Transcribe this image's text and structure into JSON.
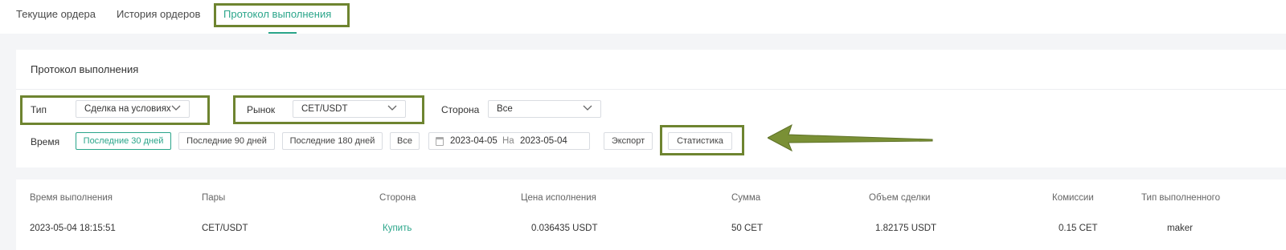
{
  "tabs": [
    {
      "label": "Текущие ордера"
    },
    {
      "label": "История ордеров"
    },
    {
      "label": "Протокол выполнения"
    }
  ],
  "panel": {
    "title": "Протокол выполнения",
    "type_label": "Тип",
    "type_value": "Сделка на условиях",
    "market_label": "Рынок",
    "market_value": "CET/USDT",
    "side_label": "Сторона",
    "side_value": "Все",
    "time_label": "Время",
    "time_buttons": [
      {
        "label": "Последние 30 дней",
        "active": true
      },
      {
        "label": "Последние 90 дней"
      },
      {
        "label": "Последние 180 дней"
      },
      {
        "label": "Все"
      }
    ],
    "date_from": "2023-04-05",
    "date_separator": "На",
    "date_to": "2023-05-04",
    "export_label": "Экспорт",
    "stats_label": "Статистика"
  },
  "table": {
    "headers": [
      "Время выполнения",
      "Пары",
      "Сторона",
      "Цена исполнения",
      "Сумма",
      "Объем сделки",
      "Комиссии",
      "Тип выполненного"
    ],
    "rows": [
      [
        "2023-05-04 18:15:51",
        "CET/USDT",
        "Купить",
        "0.036435 USDT",
        "50 CET",
        "1.82175 USDT",
        "0.15 CET",
        "maker"
      ]
    ]
  },
  "colors": {
    "accent": "#2aa58a",
    "highlight": "#6e8430"
  },
  "icons": {
    "chevron": "chevron-down-icon",
    "calendar": "calendar-icon",
    "arrow": "annotation-arrow-icon"
  }
}
